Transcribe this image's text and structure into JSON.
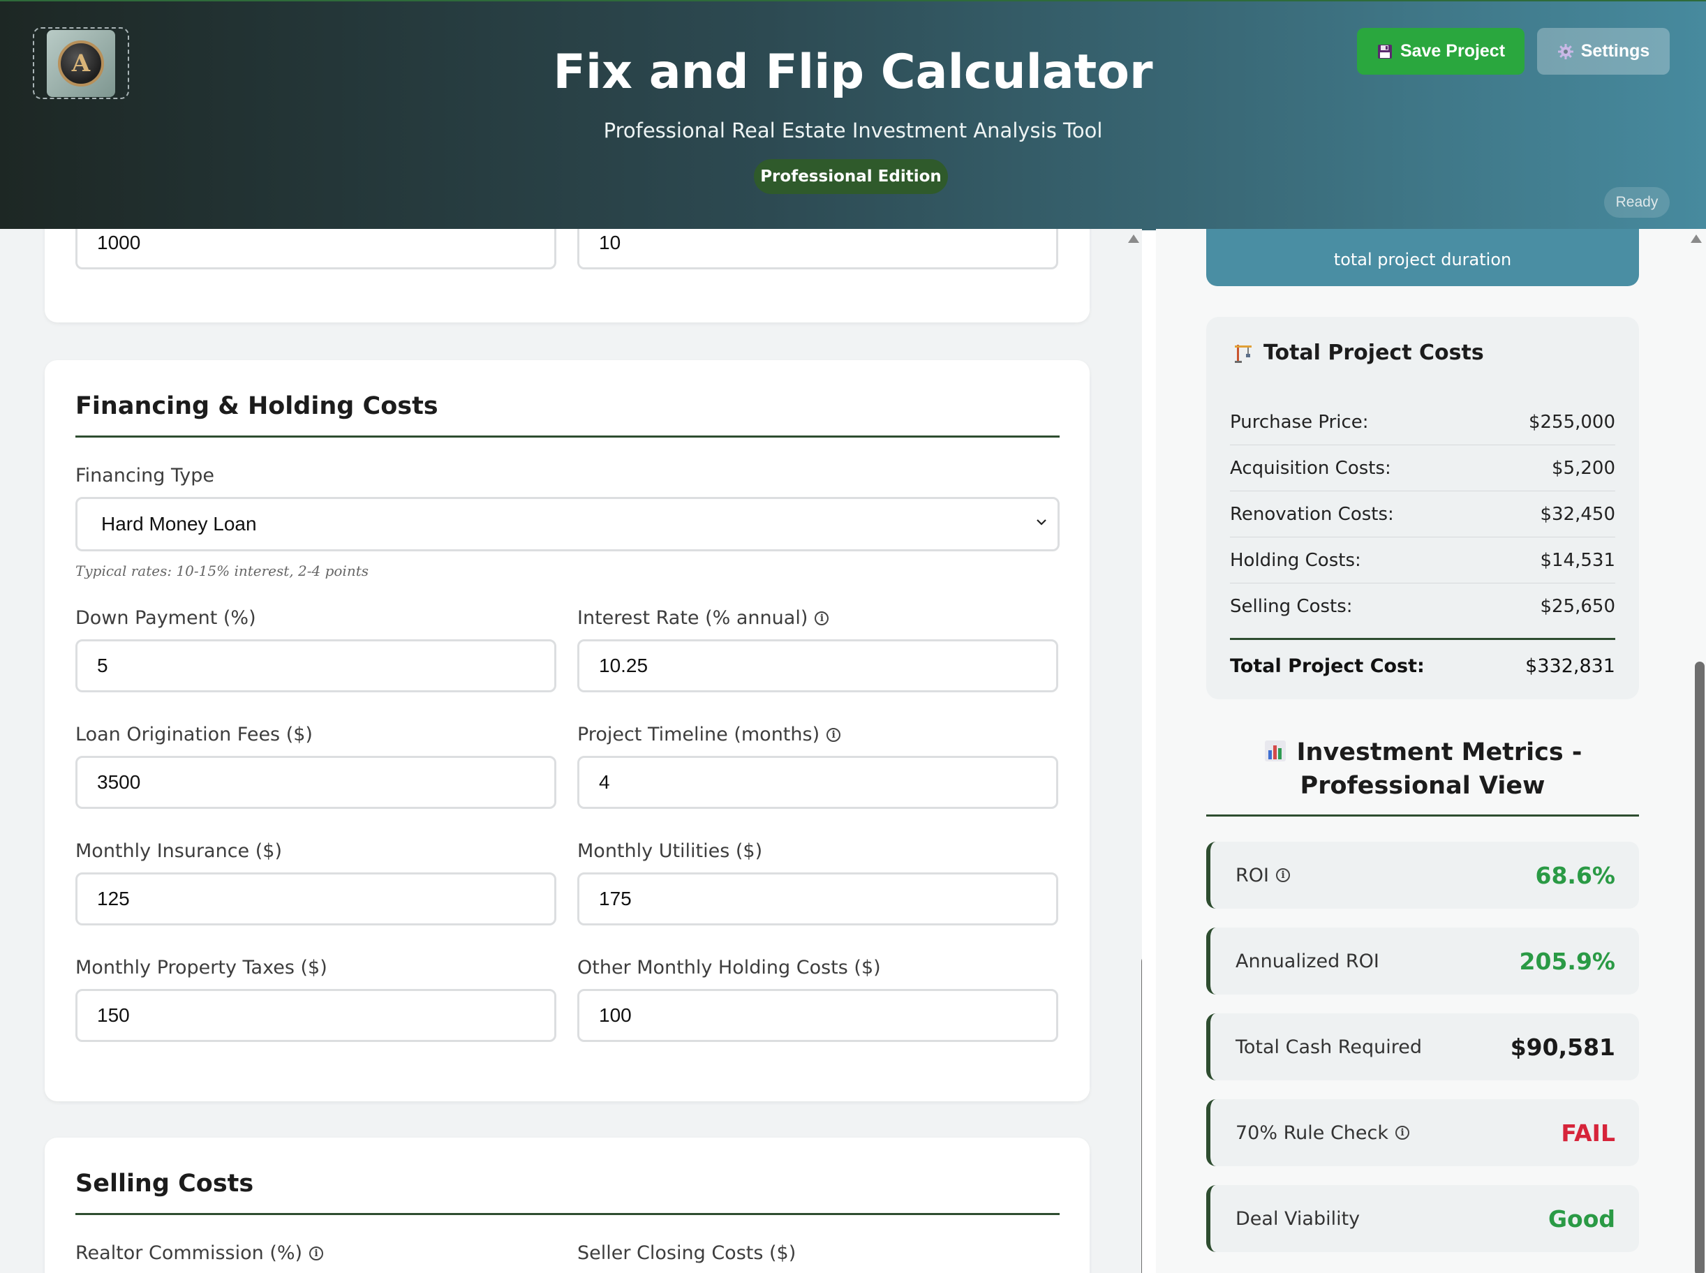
{
  "header": {
    "title": "Fix and Flip Calculator",
    "subtitle": "Professional Real Estate Investment Analysis Tool",
    "edition_badge": "Professional Edition",
    "save_button": "Save Project",
    "settings_button": "Settings",
    "status": "Ready",
    "logo_letter": "A",
    "save_icon": "floppy-disk-icon",
    "settings_icon": "gear-icon"
  },
  "top_card": {
    "field_left_value": "1000",
    "field_right_value": "10"
  },
  "financing": {
    "title": "Financing & Holding Costs",
    "financing_type_label": "Financing Type",
    "financing_type_value": "Hard Money Loan",
    "financing_hint": "Typical rates: 10-15% interest, 2-4 points",
    "down_payment_label": "Down Payment (%)",
    "down_payment_value": "5",
    "interest_rate_label": "Interest Rate (% annual)",
    "interest_rate_value": "10.25",
    "loan_fees_label": "Loan Origination Fees ($)",
    "loan_fees_value": "3500",
    "timeline_label": "Project Timeline (months)",
    "timeline_value": "4",
    "insurance_label": "Monthly Insurance ($)",
    "insurance_value": "125",
    "utilities_label": "Monthly Utilities ($)",
    "utilities_value": "175",
    "property_taxes_label": "Monthly Property Taxes ($)",
    "property_taxes_value": "150",
    "other_holding_label": "Other Monthly Holding Costs ($)",
    "other_holding_value": "100"
  },
  "selling": {
    "title": "Selling Costs",
    "realtor_label": "Realtor Commission (%)",
    "seller_closing_label": "Seller Closing Costs ($)"
  },
  "duration_card": {
    "caption": "total project duration"
  },
  "total_costs": {
    "title": "Total Project Costs",
    "icon": "construction-crane-icon",
    "rows": [
      {
        "label": "Purchase Price:",
        "value": "$255,000"
      },
      {
        "label": "Acquisition Costs:",
        "value": "$5,200"
      },
      {
        "label": "Renovation Costs:",
        "value": "$32,450"
      },
      {
        "label": "Holding Costs:",
        "value": "$14,531"
      },
      {
        "label": "Selling Costs:",
        "value": "$25,650"
      }
    ],
    "total_label": "Total Project Cost:",
    "total_value": "$332,831"
  },
  "metrics": {
    "title_line1": "Investment Metrics -",
    "title_line2": "Professional View",
    "icon": "bar-chart-icon",
    "items": [
      {
        "label": "ROI",
        "value": "68.6%",
        "color": "#2a9a45"
      },
      {
        "label": "Annualized ROI",
        "value": "205.9%",
        "color": "#2a9a45"
      },
      {
        "label": "Total Cash Required",
        "value": "$90,581",
        "color": "#1a1a1a"
      },
      {
        "label": "70% Rule Check",
        "value": "FAIL",
        "color": "#d6243a"
      },
      {
        "label": "Deal Viability",
        "value": "Good",
        "color": "#2a9a45"
      }
    ]
  },
  "colors": {
    "accent_green": "#2e4d30",
    "save_green": "#2aa73e",
    "positive": "#2a9a45",
    "negative": "#d6243a"
  }
}
